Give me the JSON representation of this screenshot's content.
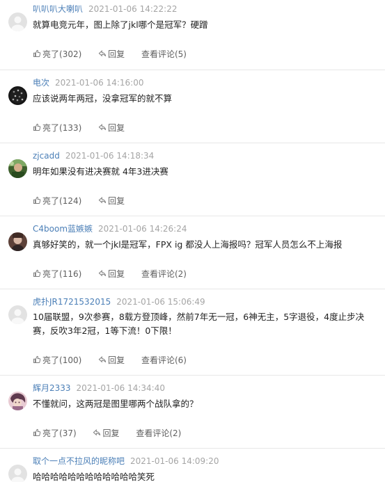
{
  "comments": [
    {
      "author": "叭叭叭大喇叭",
      "time": "2021-01-06 14:22:22",
      "text": "就算电竞元年，图上除了jkl哪个是冠军？硬蹭",
      "like_label": "亮了",
      "like_count": "(302)",
      "reply_label": "回复",
      "view_label": "查看评论",
      "view_count": "(5)",
      "avatar": "default-gray"
    },
    {
      "author": "电次",
      "time": "2021-01-06 14:16:00",
      "text": "应该说两年两冠，没拿冠军的就不算",
      "like_label": "亮了",
      "like_count": "(133)",
      "reply_label": "回复",
      "avatar": "dark-dots"
    },
    {
      "author": "zjcadd",
      "time": "2021-01-06 14:18:34",
      "text": "明年如果没有进决赛就 4年3进决赛",
      "like_label": "亮了",
      "like_count": "(124)",
      "reply_label": "回复",
      "avatar": "green-photo"
    },
    {
      "author": "C4boom蓝嫉嫉",
      "time": "2021-01-06 14:26:24",
      "text": "真够好笑的，就一个jkl是冠军，FPX ig 都没人上海报吗？冠军人员怎么不上海报",
      "like_label": "亮了",
      "like_count": "(116)",
      "reply_label": "回复",
      "view_label": "查看评论",
      "view_count": "(2)",
      "avatar": "brown-photo"
    },
    {
      "author": "虎扑JR1721532015",
      "time": "2021-01-06 15:06:49",
      "text": "10届联盟，9次参赛，8载方登顶峰，然前7年无一冠，6神无主，5字退役，4度止步决赛，反吹3年2冠，1等下流！0下限！",
      "like_label": "亮了",
      "like_count": "(100)",
      "reply_label": "回复",
      "view_label": "查看评论",
      "view_count": "(6)",
      "avatar": "default-gray"
    },
    {
      "author": "辉月2333",
      "time": "2021-01-06 14:34:40",
      "text": "不懂就问，这两冠是图里哪两个战队拿的？",
      "like_label": "亮了",
      "like_count": "(37)",
      "reply_label": "回复",
      "view_label": "查看评论",
      "view_count": "(2)",
      "avatar": "anime-photo"
    },
    {
      "author": "取个一点不拉风的昵称吧",
      "time": "2021-01-06 14:09:20",
      "text": "哈哈哈哈哈哈哈哈哈哈哈哈笑死",
      "avatar": "default-gray"
    }
  ],
  "right_edge_glyph": "๋",
  "colors": {
    "author": "#4b7fb7",
    "time": "#a5a5a5",
    "text": "#222222",
    "action": "#5f5f5f",
    "divider": "#e7e7e7"
  },
  "icons": {
    "like": "thumbs-up-icon",
    "reply": "reply-arrow-icon"
  }
}
